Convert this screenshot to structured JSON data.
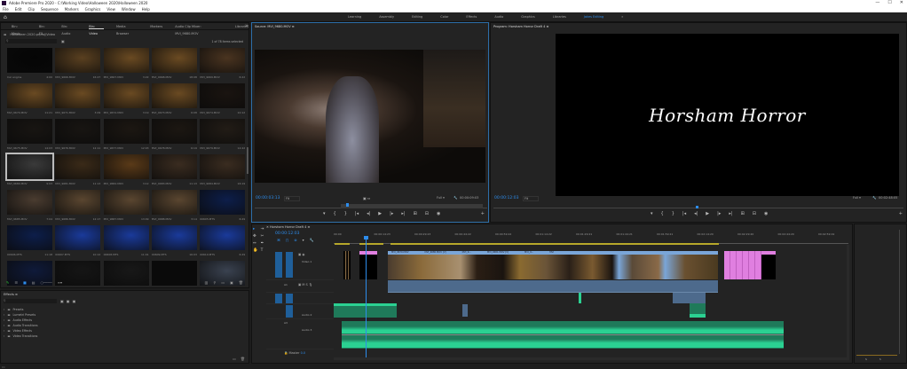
{
  "window": {
    "title": "Adobe Premiere Pro 2020 - C:\\Working Video\\Halloween 2020\\Halloween 2020",
    "controls": [
      "—",
      "☐",
      "✕"
    ]
  },
  "menu": [
    "File",
    "Edit",
    "Clip",
    "Sequence",
    "Markers",
    "Graphics",
    "View",
    "Window",
    "Help"
  ],
  "workspaces": {
    "items": [
      "Learning",
      "Assembly",
      "Editing",
      "Color",
      "Effects",
      "Audio",
      "Graphics",
      "Libraries",
      "Jakes Editing"
    ],
    "active": "Jakes Editing",
    "more": "»"
  },
  "project": {
    "tabs": [
      "Bin: Music",
      "Bin: FX",
      "Bin: Audio",
      "Bin: Video",
      "Media Browser",
      "Markers",
      "Audio Clip Mixer: MVI_9680.MOV",
      "Libraries"
    ],
    "active_tab": "Bin: Video",
    "path": "Halloween 2020.prproj\\Video",
    "search_placeholder": "",
    "selection_status": "1 of 78 items selected",
    "items": [
      {
        "name": "Car engine",
        "dur": "4:00",
        "tone": "#050505"
      },
      {
        "name": "MVI_9666.MOV",
        "dur": "16:27",
        "tone": "#5a4020"
      },
      {
        "name": "MVI_9667.MOV",
        "dur": "3:22",
        "tone": "#6a4a22"
      },
      {
        "name": "MVI_9668.MOV",
        "dur": "18:08",
        "tone": "#6a4a22"
      },
      {
        "name": "MVI_9669.MOV",
        "dur": "6:22",
        "tone": "#4a3420"
      },
      {
        "name": "MVI_9670.MOV",
        "dur": "11:21",
        "tone": "#6a4a22"
      },
      {
        "name": "MVI_9671.MOV",
        "dur": "3:09",
        "tone": "#6a4a22"
      },
      {
        "name": "MVI_9672.MOV",
        "dur": "3:19",
        "tone": "#6a4a22"
      },
      {
        "name": "MVI_9673.MOV",
        "dur": "6:08",
        "tone": "#6a4a22"
      },
      {
        "name": "MVI_9674.MOV",
        "dur": "10:12",
        "tone": "#1a1410"
      },
      {
        "name": "MVI_9675.MOV",
        "dur": "14:03",
        "tone": "#181512"
      },
      {
        "name": "MVI_9676.MOV",
        "dur": "12:11",
        "tone": "#181512"
      },
      {
        "name": "MVI_9677.MOV",
        "dur": "12:03",
        "tone": "#1c1712"
      },
      {
        "name": "MVI_9678.MOV",
        "dur": "6:19",
        "tone": "#1c1712"
      },
      {
        "name": "MVI_9679.MOV",
        "dur": "12:22",
        "tone": "#221c16"
      },
      {
        "name": "MVI_9680.MOV",
        "dur": "9:03",
        "tone": "#3a3a3a",
        "selected": true
      },
      {
        "name": "MVI_9681.MOV",
        "dur": "11:13",
        "tone": "#3a2a18"
      },
      {
        "name": "MVI_9682.MOV",
        "dur": "3:12",
        "tone": "#5a3a18"
      },
      {
        "name": "MVI_9683.MOV",
        "dur": "11:13",
        "tone": "#3a2c20"
      },
      {
        "name": "MVI_9684.MOV",
        "dur": "16:19",
        "tone": "#3a2c20"
      },
      {
        "name": "MVI_9685.MOV",
        "dur": "7:04",
        "tone": "#4a3c30"
      },
      {
        "name": "MVI_9686.MOV",
        "dur": "12:17",
        "tone": "#5a4630"
      },
      {
        "name": "MVI_9687.MOV",
        "dur": "13:09",
        "tone": "#5a4630"
      },
      {
        "name": "MVI_9688.MOV",
        "dur": "3:14",
        "tone": "#5a4630"
      },
      {
        "name": "00605.MTS",
        "dur": "6:29",
        "tone": "#0d1e4a"
      },
      {
        "name": "00606.MTS",
        "dur": "11:18",
        "tone": "#0d1e4a"
      },
      {
        "name": "00607.MTS",
        "dur": "10:12",
        "tone": "#1a3a9a"
      },
      {
        "name": "00608.MTS",
        "dur": "11:01",
        "tone": "#1a3a9a"
      },
      {
        "name": "00609.MTS",
        "dur": "16:03",
        "tone": "#1a3a9a"
      },
      {
        "name": "00610.MTS",
        "dur": "6:29",
        "tone": "#1a3a9a"
      },
      {
        "name": "",
        "dur": "",
        "tone": "#0f1a3a"
      },
      {
        "name": "",
        "dur": "",
        "tone": "#151515"
      },
      {
        "name": "",
        "dur": "",
        "tone": "#181818"
      },
      {
        "name": "",
        "dur": "",
        "tone": "#0a0a0a"
      },
      {
        "name": "",
        "dur": "",
        "tone": "#3a4250"
      }
    ]
  },
  "effects": {
    "title": "Effects",
    "folders": [
      "Presets",
      "Lumetri Presets",
      "Audio Effects",
      "Audio Transitions",
      "Video Effects",
      "Video Transitions"
    ]
  },
  "source": {
    "title": "Source: MVI_9680.MOV",
    "timecode": "00:00:03:13",
    "fit": "Fit",
    "duration": "00:00:09:03",
    "playhead_fraction": 0.37
  },
  "program": {
    "title": "Program: Horsham Horror Draft 4",
    "timecode": "00:00:12:03",
    "fit": "Fit",
    "duration": "00:02:48:05",
    "overlay_text": "Horsham Horror",
    "playhead_fraction": 0.4
  },
  "transport": [
    "▾",
    "{",
    "}",
    "|◂",
    "◂|",
    "▶",
    "|▸",
    "▸|",
    "⊞",
    "⊟",
    "◉"
  ],
  "timeline": {
    "title": "Horsham Horror Draft 4",
    "timecode": "00:00:12:03",
    "ruler": [
      "00:00",
      "00:00:14:23",
      "00:00:29:23",
      "00:00:44:22",
      "00:00:59:22",
      "00:01:14:22",
      "00:01:29:21",
      "00:01:44:21",
      "00:01:59:21",
      "00:02:14:20",
      "00:02:29:20",
      "00:02:44:20",
      "00:02:59:19"
    ],
    "tracks": [
      {
        "id": "V1",
        "name": "Video 1"
      },
      {
        "id": "A1",
        "name": ""
      },
      {
        "id": "A2",
        "name": "Audio 2"
      },
      {
        "id": "A3",
        "name": "Audio 3"
      }
    ],
    "master": "Master",
    "master_value": "0.0",
    "clip_labels": [
      "MVI_9670.MOV",
      "MVI_9680.MOV [V]",
      "MVI_9...",
      "MVI_9681.MOV [V]",
      "MVI_9...",
      "MVI"
    ]
  },
  "colors": {
    "accent": "#2d8ceb",
    "video_clip": "#7aa6d8",
    "graphic_clip": "#e07fe0",
    "audio_clip": "#2bd192",
    "audio_clip_bg": "#1f7a5a",
    "linked_audio": "#4d6a8c"
  }
}
